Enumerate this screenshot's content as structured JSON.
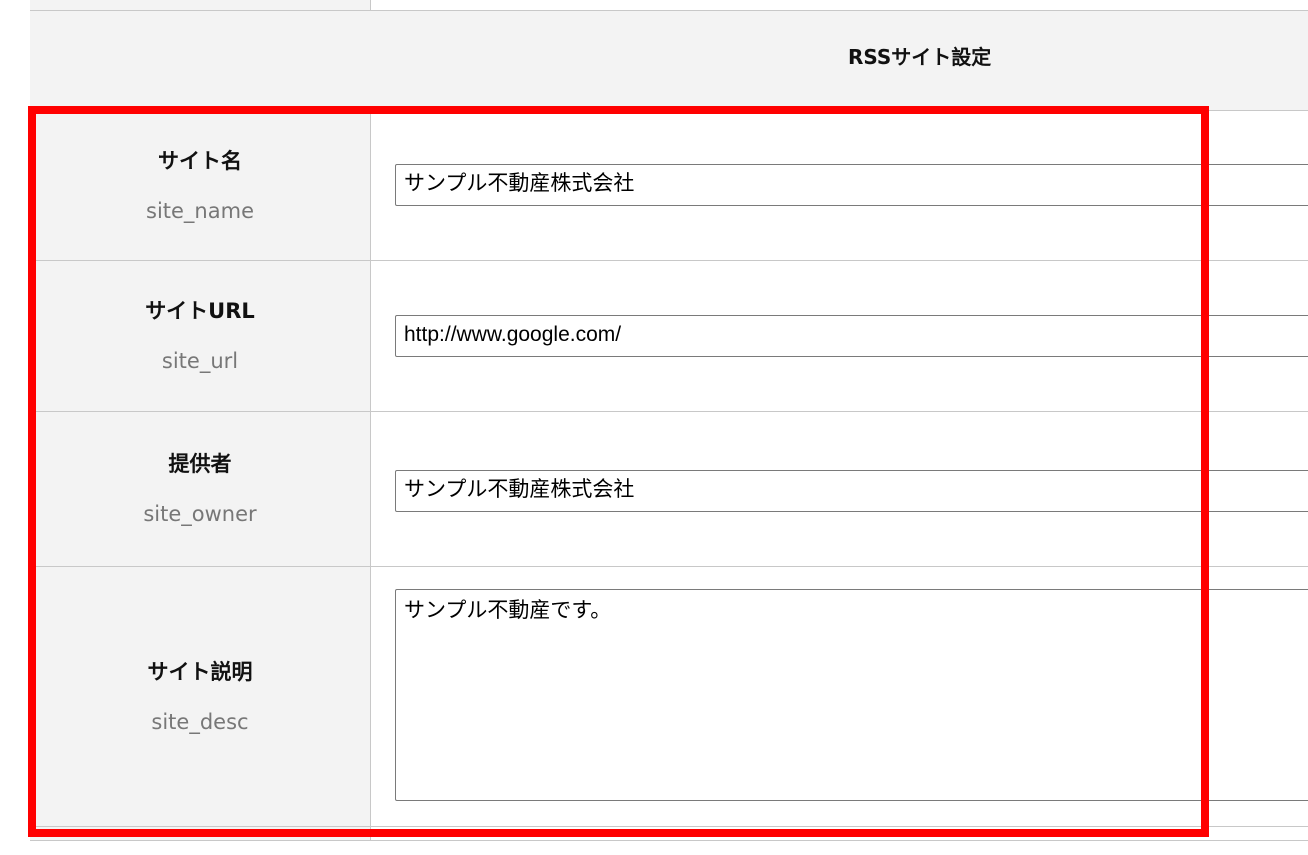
{
  "header": {
    "title": "RSSサイト設定"
  },
  "fields": [
    {
      "label": "サイト名",
      "key": "site_name",
      "value": "サンプル不動産株式会社"
    },
    {
      "label": "サイトURL",
      "key": "site_url",
      "value": "http://www.google.com/"
    },
    {
      "label": "提供者",
      "key": "site_owner",
      "value": "サンプル不動産株式会社"
    },
    {
      "label": "サイト説明",
      "key": "site_desc",
      "value": "サンプル不動産です。"
    }
  ],
  "colors": {
    "highlight": "#ff0000",
    "label_background": "#f3f3f3",
    "key_text": "#777777",
    "border": "#c8c8c8"
  }
}
